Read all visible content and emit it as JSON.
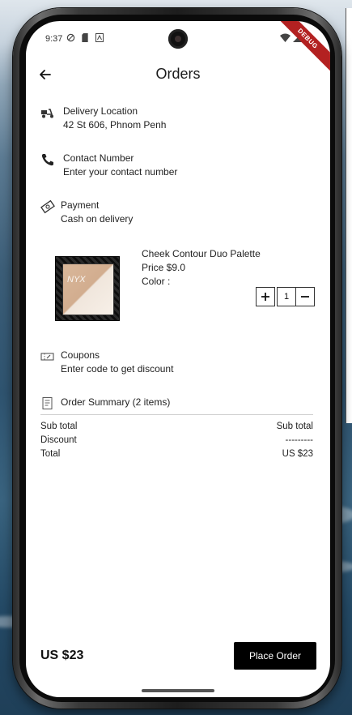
{
  "status_bar": {
    "time": "9:37",
    "debug_label": "DEBUG"
  },
  "header": {
    "title": "Orders"
  },
  "delivery": {
    "label": "Delivery Location",
    "value": "42 St 606, Phnom Penh"
  },
  "contact": {
    "label": "Contact Number",
    "value": "Enter your contact number"
  },
  "payment": {
    "label": "Payment",
    "value": "Cash on delivery"
  },
  "product": {
    "name": "Cheek Contour Duo Palette",
    "price": "Price $9.0",
    "color": "Color :",
    "quantity": "1",
    "image_logo": "NYX"
  },
  "coupons": {
    "label": "Coupons",
    "value": "Enter code to get discount"
  },
  "order_summary": {
    "title": "Order Summary (2 items)",
    "rows": [
      {
        "label": "Sub total",
        "value": "Sub total"
      },
      {
        "label": "Discount",
        "value": "---------"
      },
      {
        "label": "Total",
        "value": "US $23"
      }
    ]
  },
  "footer": {
    "total": "US $23",
    "place_order_label": "Place Order"
  }
}
